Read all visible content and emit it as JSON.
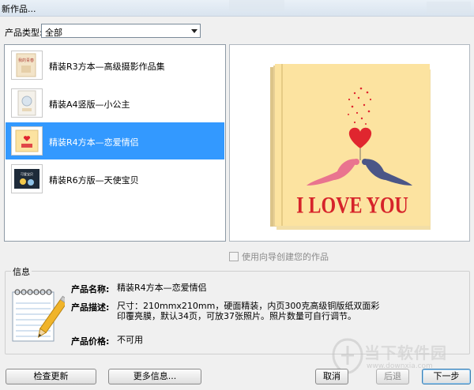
{
  "window": {
    "title": "新作品..."
  },
  "filter": {
    "label": "产品类型:",
    "value": "全部"
  },
  "products": [
    {
      "name": "精装R3方本—高级摄影作品集",
      "thumb_text": "我的青春"
    },
    {
      "name": "精装A4竖版—小公主",
      "thumb_text": ""
    },
    {
      "name": "精装R4方本—恋爱情侣",
      "thumb_text": "I LOVE YOU"
    },
    {
      "name": "精装R6方版—天使宝贝",
      "thumb_text": "可爱宝贝"
    }
  ],
  "selected_index": 2,
  "preview": {
    "cover_text": "I LOVE YOU"
  },
  "guide_checkbox": {
    "label": "使用向导创建您的作品",
    "checked": false
  },
  "info": {
    "legend": "信息",
    "name_key": "产品名称:",
    "name_value": "精装R4方本—恋爱情侣",
    "desc_key": "产品描述:",
    "desc_value": "尺寸：210mmx210mm，硬面精装，内页300克高级铜版纸双面彩印覆亮膜，默认34页，可放37张照片。照片数量可自行调节。",
    "price_key": "产品价格:",
    "price_value": "不可用"
  },
  "buttons": {
    "check_update": "检查更新",
    "more_info": "更多信息...",
    "cancel": "取消",
    "back": "后退",
    "next": "下一步"
  },
  "watermark": {
    "name": "当下软件园",
    "url": "www.downxia.com"
  },
  "colors": {
    "selection": "#3399ff",
    "cover": "#fce3a0",
    "heart": "#e0262f",
    "love_text": "#d6232a"
  }
}
